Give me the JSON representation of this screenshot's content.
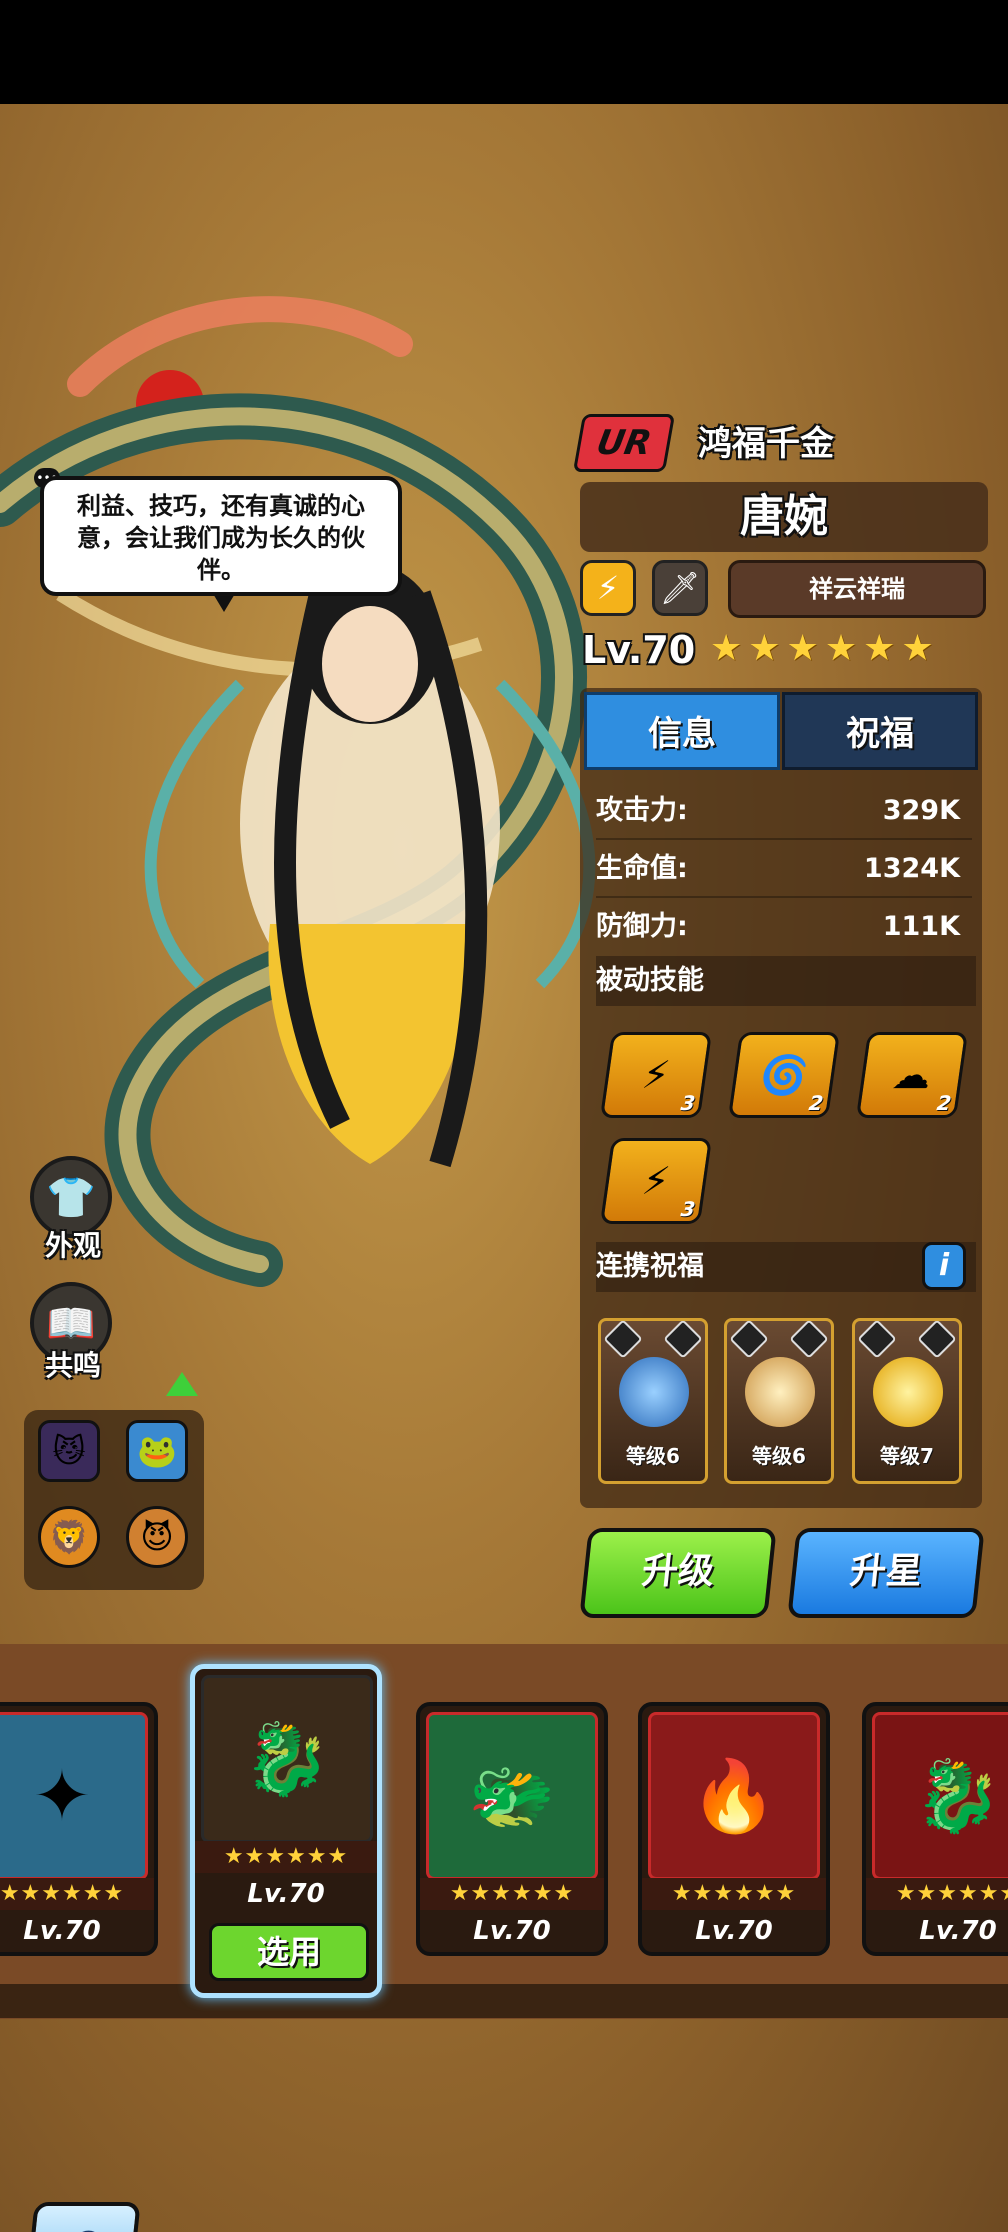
{
  "hero": {
    "rarity": "UR",
    "title": "鸿福千金",
    "name": "唐婉",
    "trait": "祥云祥瑞",
    "level": "Lv.70",
    "star_count": 6,
    "stars": "★★★★★★",
    "class_icons": [
      "lightning-icon",
      "sword-icon"
    ],
    "speech": "利益、技巧，还有真诚的心意，会让我们成为长久的伙伴。"
  },
  "tabs": [
    {
      "label": "信息",
      "active": true
    },
    {
      "label": "祝福",
      "active": false
    }
  ],
  "stats": [
    {
      "label": "攻击力:",
      "value": "329K"
    },
    {
      "label": "生命值:",
      "value": "1324K"
    },
    {
      "label": "防御力:",
      "value": "111K"
    }
  ],
  "passive": {
    "heading": "被动技能",
    "skills": [
      {
        "icon": "card-skill-icon",
        "count": "3",
        "glyph": "⚡"
      },
      {
        "icon": "wind-skill-icon",
        "count": "2",
        "glyph": "🌀"
      },
      {
        "icon": "cloud-skill-icon",
        "count": "2",
        "glyph": "☁"
      },
      {
        "icon": "crack-skill-icon",
        "count": "3",
        "glyph": "⚡"
      }
    ]
  },
  "blessing": {
    "heading": "连携祝福",
    "info_label": "i",
    "items": [
      {
        "icon": "swirl-icon",
        "level": "等级6",
        "color": "#3a8ad8"
      },
      {
        "icon": "beads-icon",
        "level": "等级6",
        "color": "#e8c070"
      },
      {
        "icon": "spark-creature-icon",
        "level": "等级7",
        "color": "#f0c020"
      }
    ]
  },
  "actions": {
    "upgrade": "升级",
    "star_up": "升星"
  },
  "side": {
    "appearance": "外观",
    "resonance": "共鸣"
  },
  "roster": [
    {
      "level": "Lv.70",
      "stars": "★★★★★★",
      "color": "#2b6a8a",
      "glyph": "✦"
    },
    {
      "level": "Lv.70",
      "stars": "★★★★★★",
      "color": "#3a2a1a",
      "glyph": "🐉",
      "selected": true,
      "select_label": "选用"
    },
    {
      "level": "Lv.70",
      "stars": "★★★★★★",
      "color": "#1e6a3a",
      "glyph": "🐲"
    },
    {
      "level": "Lv.70",
      "stars": "★★★★★★",
      "color": "#8a1a1a",
      "glyph": "🔥"
    },
    {
      "level": "Lv.70",
      "stars": "★★★★★★",
      "color": "#7a1414",
      "glyph": "🐉"
    }
  ],
  "colors": {
    "accent_blue": "#2f8ee0",
    "accent_green": "#6dd62e",
    "rarity_red": "#e0313c",
    "star": "#ffd23a"
  }
}
